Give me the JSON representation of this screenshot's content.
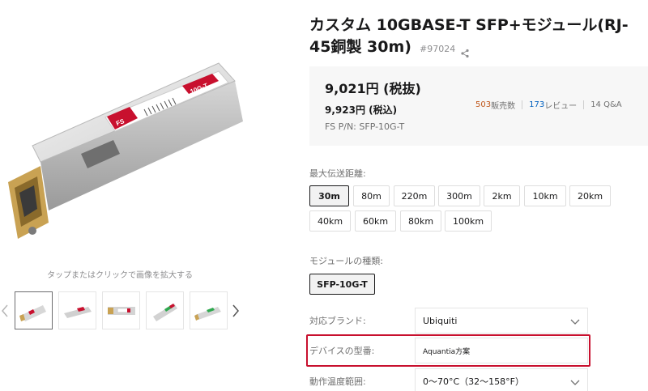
{
  "product": {
    "title": "カスタム 10GBASE-T SFP+モジュール(RJ-45銅製 30m)",
    "sku": "#97024",
    "module_text": "10G-T",
    "module_badge": "FS"
  },
  "gallery": {
    "zoom_hint": "タップまたはクリックで画像を拡大する",
    "thumb_count": 5
  },
  "price": {
    "main": "9,021円 (税抜)",
    "tax_incl": "9,923円 (税込)",
    "pn": "FS P/N: SFP-10G-T",
    "sold_num": "503",
    "sold_label": " 販売数",
    "review_num": "173",
    "review_label": " レビュー",
    "qa": "14 Q&A"
  },
  "distance": {
    "label": "最大伝送距離:",
    "options": [
      "30m",
      "80m",
      "220m",
      "300m",
      "2km",
      "10km",
      "20km",
      "40km",
      "60km",
      "80km",
      "100km"
    ],
    "selected": "30m"
  },
  "module_type": {
    "label": "モジュールの種類:",
    "options": [
      "SFP-10G-T"
    ],
    "selected": "SFP-10G-T"
  },
  "specs": {
    "brand_label": "対応ブランド:",
    "brand_value": "Ubiquiti",
    "device_label": "デバイスの型番:",
    "device_value": "Aquantia方案",
    "temp_label": "動作温度範囲:",
    "temp_value": "0～70°C（32～158°F）"
  },
  "colors": {
    "accent_red": "#c8102e",
    "sold": "#c0571b",
    "review": "#0060bf"
  }
}
